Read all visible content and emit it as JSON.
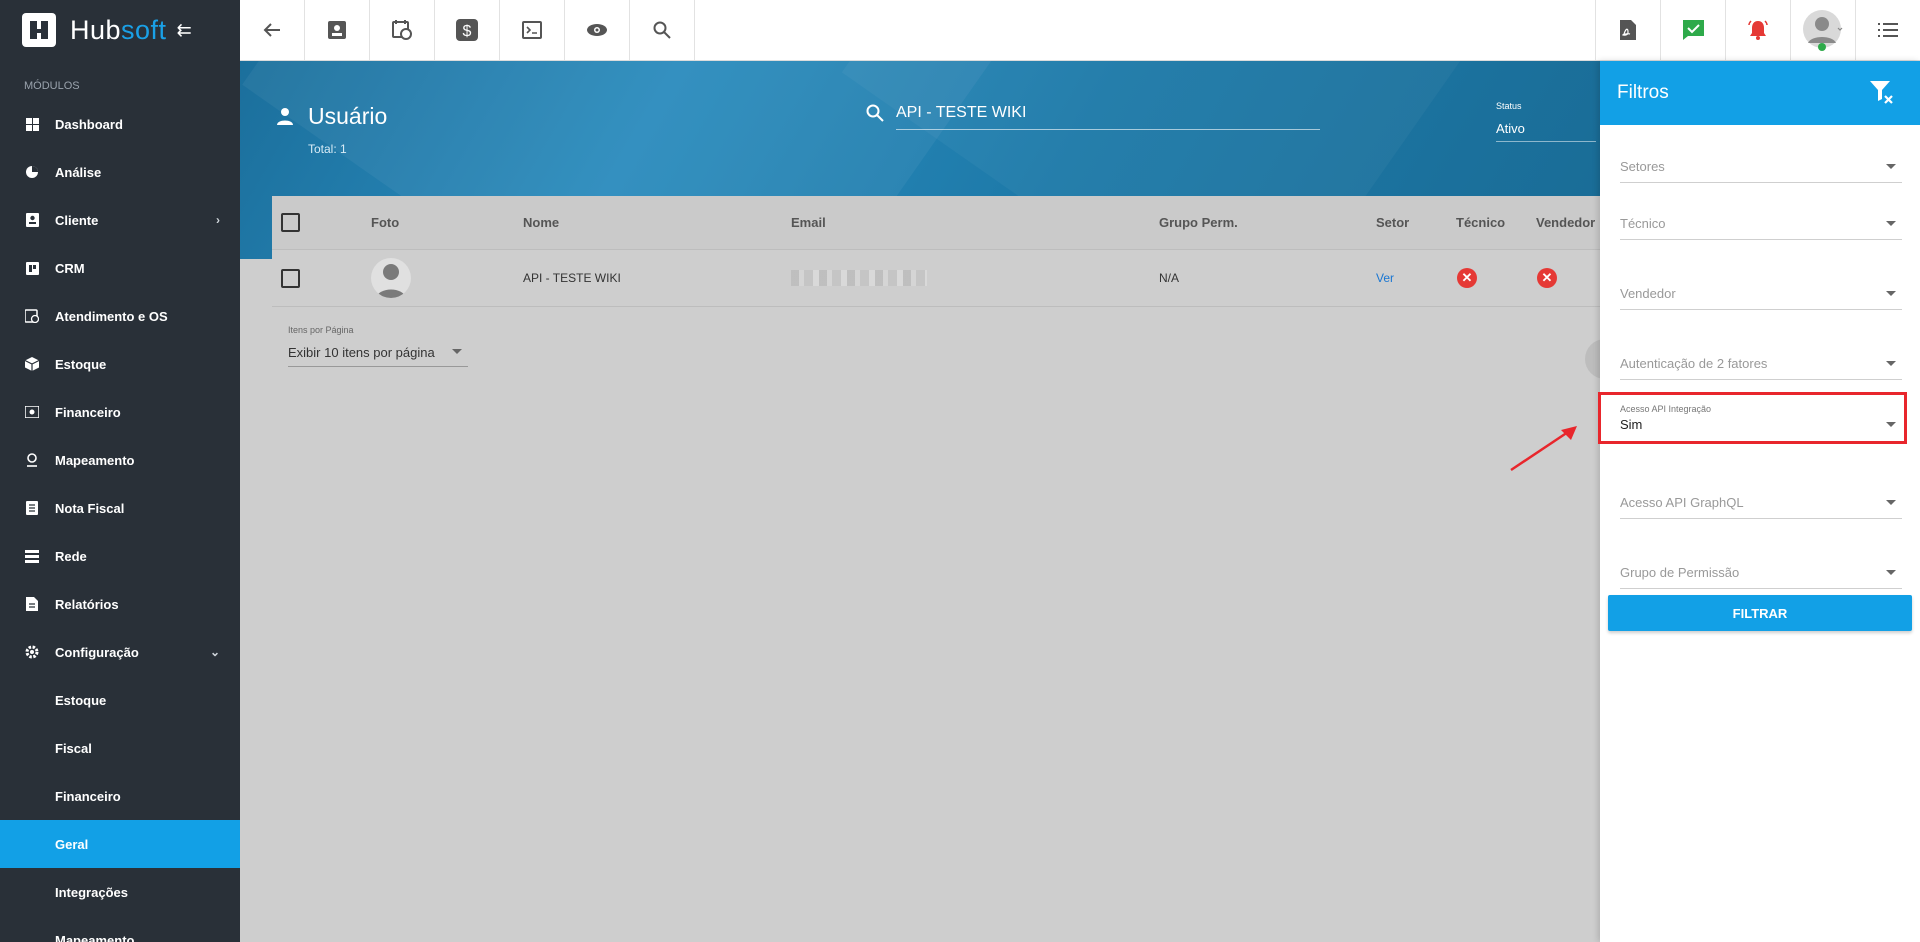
{
  "brand": {
    "part1": "Hub",
    "part2": "soft"
  },
  "sidebar": {
    "section_title": "MÓDULOS",
    "items": [
      {
        "label": "Dashboard",
        "icon": "dashboard-icon"
      },
      {
        "label": "Análise",
        "icon": "pie-chart-icon"
      },
      {
        "label": "Cliente",
        "icon": "contact-card-icon"
      },
      {
        "label": "CRM",
        "icon": "crm-icon"
      },
      {
        "label": "Atendimento e OS",
        "icon": "calendar-clock-icon"
      },
      {
        "label": "Estoque",
        "icon": "box-icon"
      },
      {
        "label": "Financeiro",
        "icon": "money-icon"
      },
      {
        "label": "Mapeamento",
        "icon": "map-pin-icon"
      },
      {
        "label": "Nota Fiscal",
        "icon": "document-icon"
      },
      {
        "label": "Rede",
        "icon": "network-icon"
      },
      {
        "label": "Relatórios",
        "icon": "report-icon"
      },
      {
        "label": "Configuração",
        "icon": "gear-icon"
      }
    ],
    "sub_items": [
      {
        "label": "Estoque"
      },
      {
        "label": "Fiscal"
      },
      {
        "label": "Financeiro"
      },
      {
        "label": "Geral",
        "active": true
      },
      {
        "label": "Integrações"
      },
      {
        "label": "Mapeamento"
      }
    ]
  },
  "page": {
    "title": "Usuário",
    "total": "Total: 1",
    "search_value": "API - TESTE WIKI",
    "status_label": "Status",
    "status_value": "Ativo"
  },
  "table": {
    "columns": [
      "Foto",
      "Nome",
      "Email",
      "Grupo Perm.",
      "Setor",
      "Técnico",
      "Vendedor"
    ],
    "rows": [
      {
        "nome": "API - TESTE WIKI",
        "grupo": "N/A",
        "setor": "Ver"
      }
    ]
  },
  "pager": {
    "label": "Itens por Página",
    "value": "Exibir 10 itens por página"
  },
  "filters": {
    "title": "Filtros",
    "fields": [
      {
        "placeholder": "Setores"
      },
      {
        "placeholder": "Técnico"
      },
      {
        "placeholder": "Vendedor"
      },
      {
        "placeholder": "Autenticação de 2 fatores"
      },
      {
        "label": "Acesso API Integração",
        "value": "Sim"
      },
      {
        "placeholder": "Acesso API GraphQL"
      },
      {
        "placeholder": "Grupo de Permissão"
      }
    ],
    "button": "FILTRAR"
  },
  "colors": {
    "accent": "#12a0e6",
    "sidebar_bg": "#293038",
    "highlight": "#e8262c"
  }
}
